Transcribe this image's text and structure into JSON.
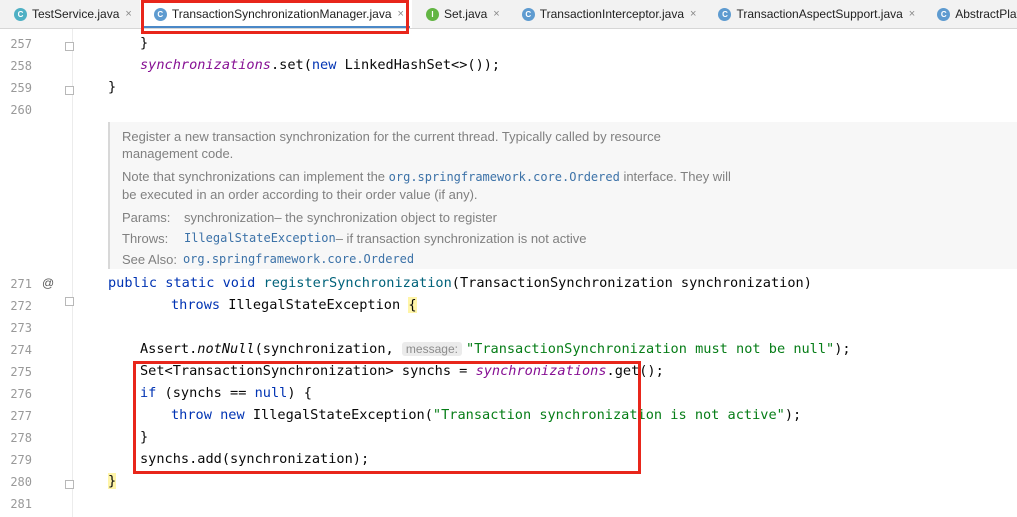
{
  "tabs": [
    {
      "label": "TestService.java",
      "icon": "C",
      "active": false,
      "close": "×"
    },
    {
      "label": "TransactionSynchronizationManager.java",
      "icon": "C",
      "active": true,
      "close": "×"
    },
    {
      "label": "Set.java",
      "icon": "I",
      "active": false,
      "close": "×"
    },
    {
      "label": "TransactionInterceptor.java",
      "icon": "C",
      "active": false,
      "close": "×"
    },
    {
      "label": "TransactionAspectSupport.java",
      "icon": "C",
      "active": false,
      "close": "×"
    },
    {
      "label": "AbstractPlatform",
      "icon": "C",
      "active": false,
      "close": ""
    }
  ],
  "line_numbers": {
    "l257": "257",
    "l258": "258",
    "l259": "259",
    "l260": "260",
    "l271": "271",
    "l272": "272",
    "l273": "273",
    "l274": "274",
    "l275": "275",
    "l276": "276",
    "l277": "277",
    "l278": "278",
    "l279": "279",
    "l280": "280",
    "l281": "281"
  },
  "gutter": {
    "override_marker": "@"
  },
  "code": {
    "l257": "}",
    "l258": {
      "field": "synchronizations",
      "rest": ".set(",
      "kw": "new",
      "rest2": " LinkedHashSet<>());"
    },
    "l259": "}",
    "l271": {
      "kw1": "public",
      "kw2": "static",
      "kw3": "void",
      "name": "registerSynchronization",
      "params": "(TransactionSynchronization synchronization)"
    },
    "l272": {
      "kw": "throws",
      "rest": " IllegalStateException ",
      "brace": "{"
    },
    "l274": {
      "cls": "Assert.",
      "method": "notNull",
      "args": "(synchronization, ",
      "hint": "message:",
      "str": "\"TransactionSynchronization must not be null\"",
      "end": ");"
    },
    "l275": {
      "pre": "Set<TransactionSynchronization> synchs = ",
      "field": "synchronizations",
      "post": ".get();"
    },
    "l276": {
      "kw": "if",
      "pre": " (synchs == ",
      "kw2": "null",
      "post": ") {"
    },
    "l277": {
      "kw1": "throw",
      "kw2": "new",
      "cls": " IllegalStateException(",
      "str": "\"Transaction synchronization is not active\"",
      "end": ");"
    },
    "l278": "}",
    "l279": "synchs.add(synchronization);",
    "l280": "}"
  },
  "doc": {
    "p1": "Register a new transaction synchronization for the current thread. Typically called by resource management code.",
    "p2_a": "Note that synchronizations can implement the ",
    "p2_code": "org.springframework.core.Ordered",
    "p2_b": " interface. They will be executed in an order according to their order value (if any).",
    "params_label": "Params:",
    "params_name": "synchronization",
    "params_desc": " – the synchronization object to register",
    "throws_label": "Throws:",
    "throws_name": "IllegalStateException",
    "throws_desc": " – if transaction synchronization is not active",
    "see_label": "See Also:",
    "see_value": "org.springframework.core.Ordered"
  },
  "colors": {
    "keyword": "#0033b3",
    "field": "#871094",
    "method_decl": "#00627a",
    "string": "#067d17",
    "annotation_box": "#e8261b",
    "active_tab_underline": "#4a88c7"
  }
}
